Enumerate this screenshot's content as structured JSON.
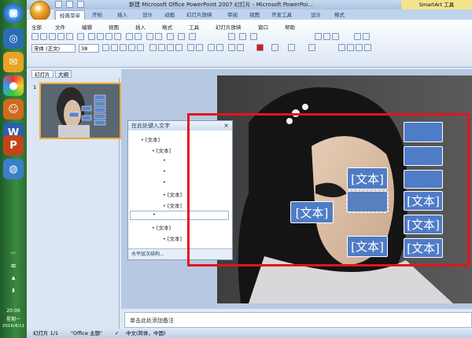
{
  "window": {
    "title": "新建 Microsoft Office PowerPoint 2007 幻灯片 - Microsoft PowerPoi...",
    "contextual_tab": "SmartArt 工具"
  },
  "tabs": [
    "经典菜单",
    "开始",
    "插入",
    "设计",
    "动画",
    "幻灯片放映",
    "审阅",
    "视图",
    "开发工具",
    "设计",
    "格式"
  ],
  "menu": [
    "全部",
    "文件",
    "编辑",
    "视图",
    "插入",
    "格式",
    "工具",
    "幻灯片放映",
    "窗口",
    "帮助"
  ],
  "font": {
    "name": "宋体 (正文)",
    "size": "38"
  },
  "pane_tabs": {
    "slides": "幻灯片",
    "outline": "大纲"
  },
  "slide_number": "1",
  "text_pane": {
    "title": "在此处键入文字",
    "close": "×",
    "lines": [
      "[文本]",
      "[文本]",
      "",
      "",
      "",
      "[文本]",
      "[文本]",
      "",
      "[文本]",
      "[文本]"
    ],
    "footer": "水平层次结构..."
  },
  "smartart": {
    "label": "[文本]"
  },
  "notes_placeholder": "单击此处添加备注",
  "status": {
    "slide": "幻灯片 1/1",
    "theme": "\"Office 主题\"",
    "lang": "中文(简体，中国)"
  },
  "clock": {
    "time": "20:06",
    "weekday": "星期一",
    "date": "2016/4/11"
  },
  "colors": {
    "accent_red": "#e3141c",
    "smartart_blue": "#4f7cc6"
  }
}
